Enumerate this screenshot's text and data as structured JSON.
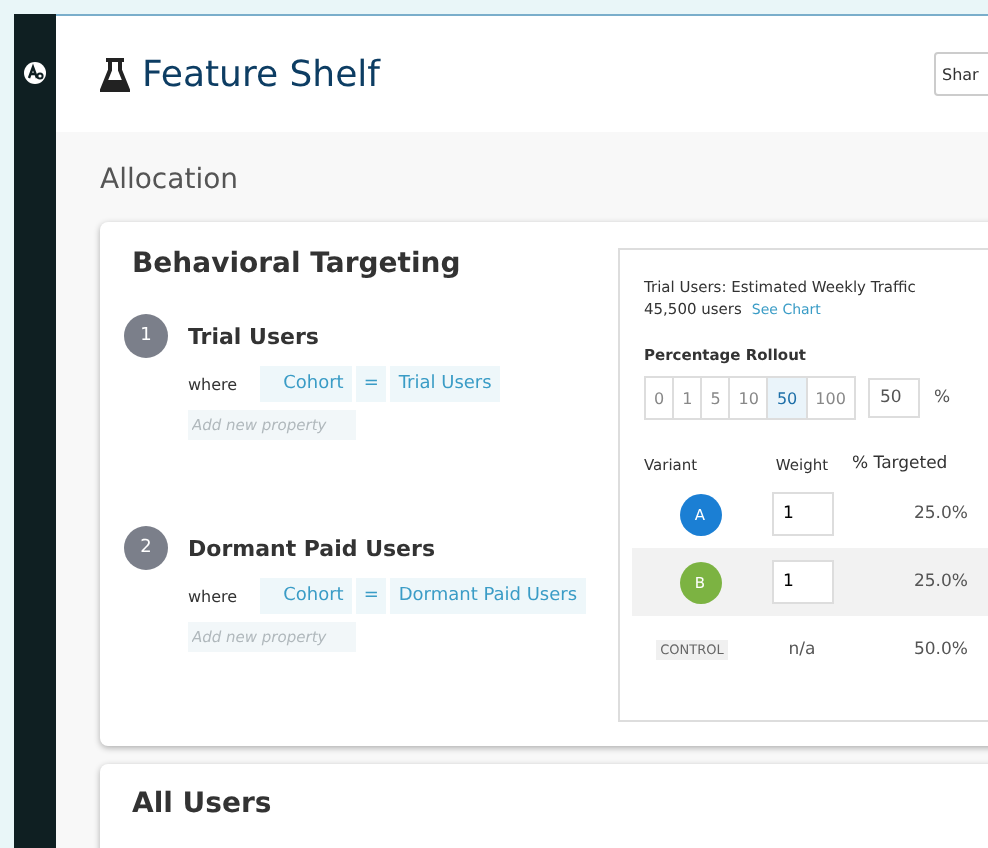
{
  "header": {
    "title": "Feature Shelf",
    "share_button": "Shar"
  },
  "section_title": "Allocation",
  "targeting": {
    "title": "Behavioral Targeting",
    "rules": [
      {
        "number": "1",
        "name": "Trial Users",
        "where": "where",
        "property": "Cohort",
        "operator": "=",
        "value": "Trial Users",
        "add_placeholder": "Add new property"
      },
      {
        "number": "2",
        "name": "Dormant Paid Users",
        "where": "where",
        "property": "Cohort",
        "operator": "=",
        "value": "Dormant Paid Users",
        "add_placeholder": "Add new property"
      }
    ]
  },
  "traffic": {
    "title": "Trial Users: Estimated Weekly Traffic",
    "users": "45,500 users",
    "link": "See Chart"
  },
  "rollout": {
    "label": "Percentage Rollout",
    "options": [
      {
        "label": "0",
        "selected": false
      },
      {
        "label": "1",
        "selected": false
      },
      {
        "label": "5",
        "selected": false
      },
      {
        "label": "10",
        "selected": false
      },
      {
        "label": "50",
        "selected": true
      },
      {
        "label": "100",
        "selected": false
      }
    ],
    "value": "50",
    "unit": "%"
  },
  "variants": {
    "columns": [
      "Variant",
      "Weight",
      "% Targeted"
    ],
    "rows": [
      {
        "kind": "variant",
        "label": "A",
        "color": "#1b7fd4",
        "weight": "1",
        "targeted": "25.0%",
        "selected": false
      },
      {
        "kind": "variant",
        "label": "B",
        "color": "#7cb342",
        "weight": "1",
        "targeted": "25.0%",
        "selected": true
      },
      {
        "kind": "control",
        "label": "CONTROL",
        "weight": "n/a",
        "targeted": "50.0%",
        "selected": false
      }
    ]
  },
  "next_section": {
    "title": "All Users"
  }
}
